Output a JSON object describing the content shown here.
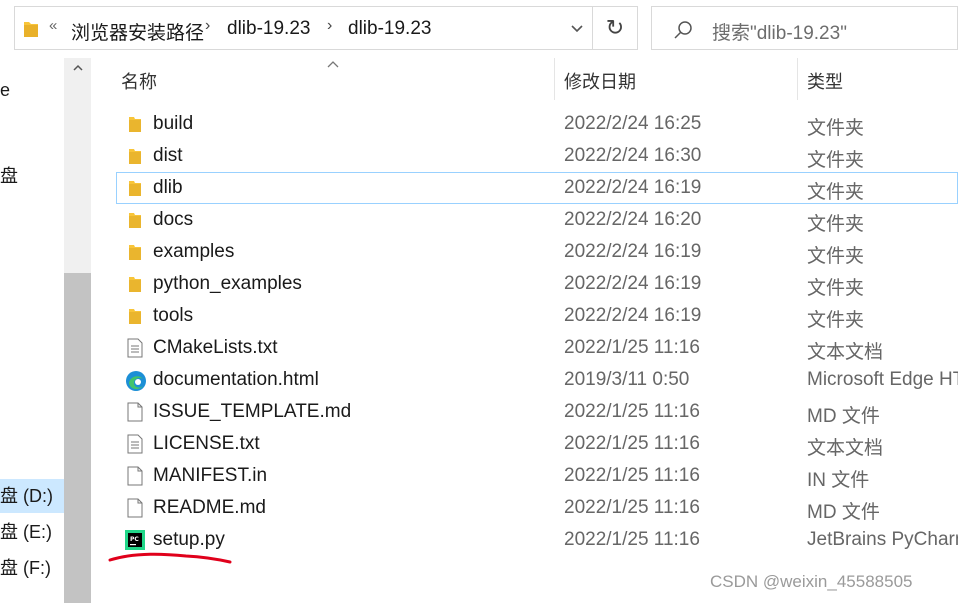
{
  "breadcrumb": {
    "overflow": "«",
    "items": [
      "浏览器安装路径",
      "dlib-19.23",
      "dlib-19.23"
    ]
  },
  "search": {
    "placeholder": "搜索\"dlib-19.23\""
  },
  "nav": {
    "fragments": [
      "e",
      "盘"
    ],
    "drives": [
      {
        "label": "盘 (D:)",
        "selected": true
      },
      {
        "label": "盘 (E:)",
        "selected": false
      },
      {
        "label": "盘 (F:)",
        "selected": false
      }
    ]
  },
  "columns": {
    "name": "名称",
    "date": "修改日期",
    "type": "类型"
  },
  "files": [
    {
      "name": "build",
      "date": "2022/2/24 16:25",
      "type": "文件夹",
      "icon": "folder-icon"
    },
    {
      "name": "dist",
      "date": "2022/2/24 16:30",
      "type": "文件夹",
      "icon": "folder-icon"
    },
    {
      "name": "dlib",
      "date": "2022/2/24 16:19",
      "type": "文件夹",
      "icon": "folder-icon",
      "focused": true
    },
    {
      "name": "docs",
      "date": "2022/2/24 16:20",
      "type": "文件夹",
      "icon": "folder-icon"
    },
    {
      "name": "examples",
      "date": "2022/2/24 16:19",
      "type": "文件夹",
      "icon": "folder-icon"
    },
    {
      "name": "python_examples",
      "date": "2022/2/24 16:19",
      "type": "文件夹",
      "icon": "folder-icon"
    },
    {
      "name": "tools",
      "date": "2022/2/24 16:19",
      "type": "文件夹",
      "icon": "folder-icon"
    },
    {
      "name": "CMakeLists.txt",
      "date": "2022/1/25 11:16",
      "type": "文本文档",
      "icon": "text-document-icon"
    },
    {
      "name": "documentation.html",
      "date": "2019/3/11 0:50",
      "type": "Microsoft Edge HT",
      "icon": "edge-icon"
    },
    {
      "name": "ISSUE_TEMPLATE.md",
      "date": "2022/1/25 11:16",
      "type": "MD 文件",
      "icon": "blank-file-icon"
    },
    {
      "name": "LICENSE.txt",
      "date": "2022/1/25 11:16",
      "type": "文本文档",
      "icon": "text-document-icon"
    },
    {
      "name": "MANIFEST.in",
      "date": "2022/1/25 11:16",
      "type": "IN 文件",
      "icon": "blank-file-icon"
    },
    {
      "name": "README.md",
      "date": "2022/1/25 11:16",
      "type": "MD 文件",
      "icon": "blank-file-icon"
    },
    {
      "name": "setup.py",
      "date": "2022/1/25 11:16",
      "type": "JetBrains PyCharm",
      "icon": "pycharm-icon"
    }
  ],
  "watermark": "CSDN @weixin_45588505",
  "colors": {
    "selection": "#cce8ff",
    "focus_outline": "#99d1ff",
    "folder": "#f8c53a",
    "annotation": "#e0001b"
  }
}
